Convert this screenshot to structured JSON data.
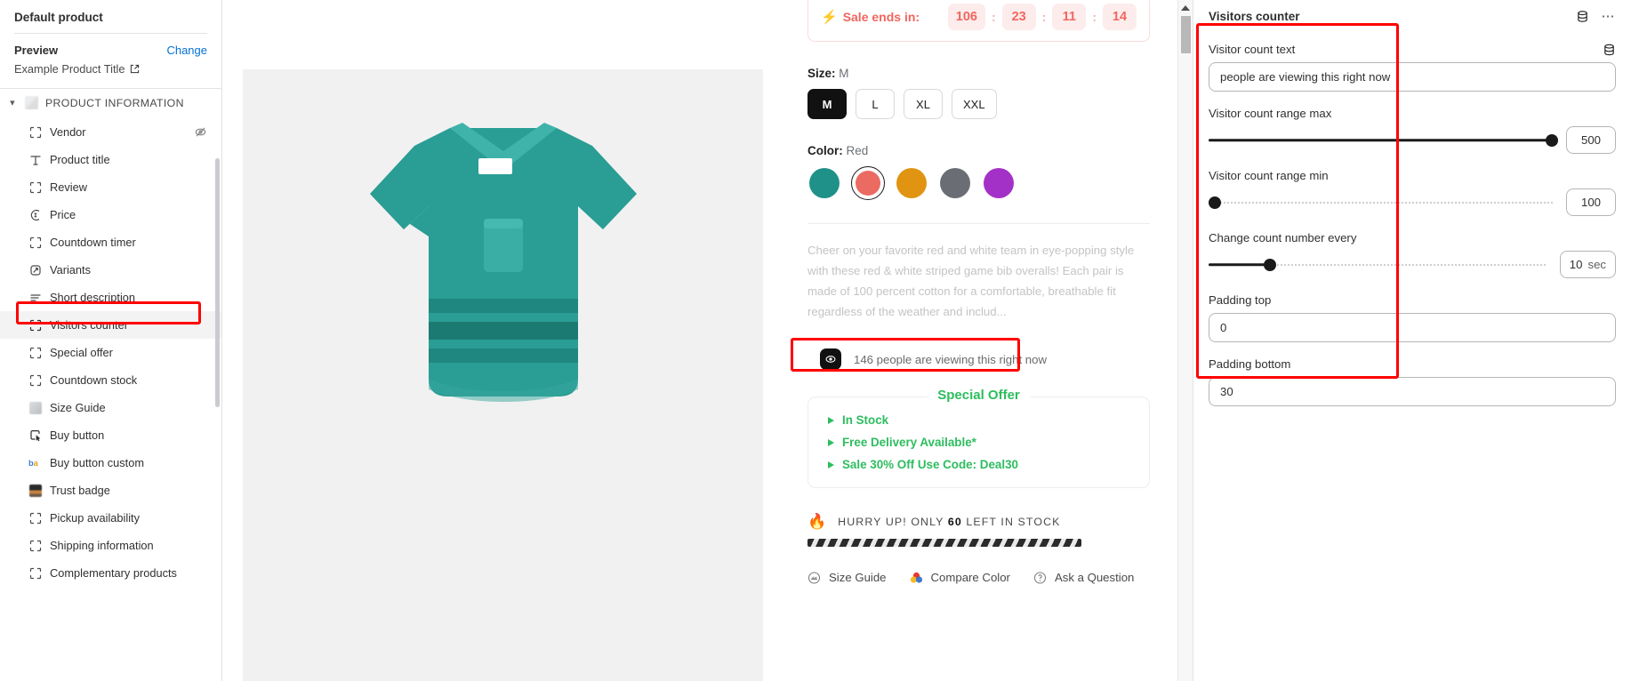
{
  "sidebar": {
    "title": "Default product",
    "preview": {
      "label": "Preview",
      "change_label": "Change",
      "product_title": "Example Product Title",
      "external_icon": "external-link-icon"
    },
    "section": {
      "label": "PRODUCT INFORMATION",
      "chevron": "chevron-down-icon"
    },
    "items": [
      {
        "label": "Vendor",
        "icon": "placeholder-block-icon",
        "trailing_icon": "eye-off-icon",
        "selected": false
      },
      {
        "label": "Product title",
        "icon": "text-icon",
        "selected": false
      },
      {
        "label": "Review",
        "icon": "placeholder-block-icon",
        "selected": false
      },
      {
        "label": "Price",
        "icon": "price-tag-icon",
        "selected": false
      },
      {
        "label": "Countdown timer",
        "icon": "placeholder-block-icon",
        "selected": false
      },
      {
        "label": "Variants",
        "icon": "variants-icon",
        "selected": false
      },
      {
        "label": "Short description",
        "icon": "text-lines-icon",
        "selected": false
      },
      {
        "label": "Visitors counter",
        "icon": "placeholder-block-icon",
        "selected": true
      },
      {
        "label": "Special offer",
        "icon": "placeholder-block-icon",
        "selected": false
      },
      {
        "label": "Countdown stock",
        "icon": "placeholder-block-icon",
        "selected": false
      },
      {
        "label": "Size Guide",
        "icon": "size-guide-icon",
        "selected": false
      },
      {
        "label": "Buy button",
        "icon": "cursor-click-icon",
        "selected": false
      },
      {
        "label": "Buy button custom",
        "icon": "buy-custom-icon",
        "selected": false
      },
      {
        "label": "Trust badge",
        "icon": "trust-badge-icon",
        "selected": false
      },
      {
        "label": "Pickup availability",
        "icon": "placeholder-block-icon",
        "selected": false
      },
      {
        "label": "Shipping information",
        "icon": "placeholder-block-icon",
        "selected": false
      },
      {
        "label": "Complementary products",
        "icon": "placeholder-block-icon",
        "selected": false
      }
    ]
  },
  "preview_pane": {
    "countdown": {
      "label": "Sale ends in:",
      "bolt_icon": "lightning-bolt-icon",
      "values": [
        "106",
        "23",
        "11",
        "14"
      ],
      "separator": ":"
    },
    "size": {
      "label": "Size:",
      "selected": "M",
      "options": [
        "M",
        "L",
        "XL",
        "XXL"
      ]
    },
    "color": {
      "label": "Color:",
      "selected": "Red",
      "swatches": [
        {
          "name": "teal",
          "hex": "#1f9189"
        },
        {
          "name": "red",
          "hex": "#eb6a62"
        },
        {
          "name": "orange",
          "hex": "#e09412"
        },
        {
          "name": "gray",
          "hex": "#6a6e74"
        },
        {
          "name": "purple",
          "hex": "#a431c7"
        }
      ]
    },
    "description": "Cheer on your favorite red and white team in eye-popping style with these red & white striped game bib overalls! Each pair is made of 100 percent cotton for a comfortable, breathable fit regardless of the weather and includ...",
    "visitors_counter": {
      "icon": "eye-icon",
      "count": "146",
      "text": "people are viewing this right now",
      "full_text": "146 people are viewing this right now"
    },
    "special_offer": {
      "title": "Special Offer",
      "items": [
        "In Stock",
        "Free Delivery Available*",
        "Sale 30% Off Use Code: Deal30"
      ],
      "accent": "#2dbd5f"
    },
    "stock": {
      "fire_icon": "fire-icon",
      "prefix": "HURRY UP! ONLY",
      "count": "60",
      "suffix": "LEFT IN STOCK"
    },
    "links": [
      {
        "label": "Size Guide",
        "icon": "size-guide-icon"
      },
      {
        "label": "Compare Color",
        "icon": "color-circles-icon"
      },
      {
        "label": "Ask a Question",
        "icon": "question-mark-icon"
      }
    ]
  },
  "settings": {
    "title": "Visitors counter",
    "database_icon": "database-icon",
    "more_icon": "more-options-icon",
    "fields": [
      {
        "label": "Visitor count text",
        "type": "text",
        "value": "people are viewing this right now",
        "trailing_icon": "database-icon"
      },
      {
        "label": "Visitor count range max",
        "type": "slider",
        "value": "500",
        "fill_percent": 100
      },
      {
        "label": "Visitor count range min",
        "type": "slider",
        "value": "100",
        "fill_percent": 0
      },
      {
        "label": "Change count number every",
        "type": "slider",
        "value": "10",
        "unit": "sec",
        "fill_percent": 18
      },
      {
        "label": "Padding top",
        "type": "text",
        "value": "0"
      },
      {
        "label": "Padding bottom",
        "type": "text",
        "value": "30"
      }
    ]
  },
  "colors": {
    "highlight": "#ff0000",
    "link": "#0570d6",
    "accent_green": "#2dbd5f",
    "accent_red": "#f1665f"
  }
}
